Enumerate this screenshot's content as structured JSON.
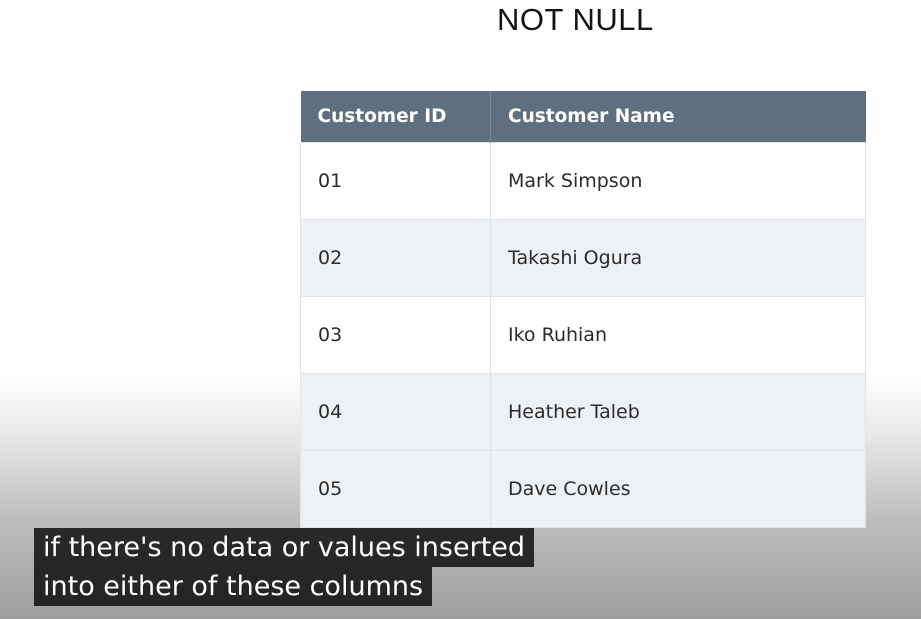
{
  "slide": {
    "title": "NOT NULL"
  },
  "table": {
    "headers": [
      "Customer ID",
      "Customer Name"
    ],
    "rows": [
      {
        "id": "01",
        "name": "Mark Simpson"
      },
      {
        "id": "02",
        "name": "Takashi Ogura"
      },
      {
        "id": "03",
        "name": "Iko Ruhian"
      },
      {
        "id": "04",
        "name": "Heather Taleb"
      },
      {
        "id": "05",
        "name": "Dave Cowles"
      }
    ]
  },
  "captions": {
    "lines": [
      "if there's no data or values inserted",
      "into either of these columns"
    ]
  },
  "colors": {
    "header_bg": "#5f6f80",
    "header_text": "#ffffff",
    "row_alt_bg": "#eef1f4",
    "caption_bg": "#0d0d0d"
  }
}
